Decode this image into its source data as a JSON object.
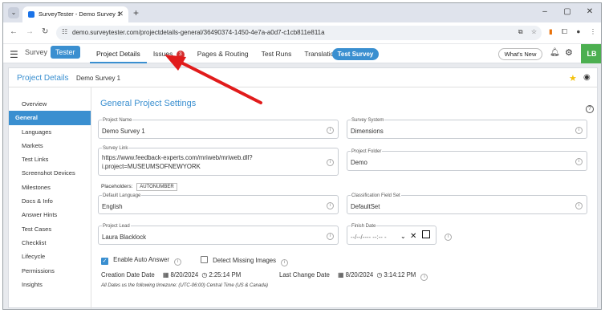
{
  "browser": {
    "tab_title": "SurveyTester - Demo Survey 1",
    "url": "demo.surveytester.com/projectdetails-general/36490374-1450-4e7a-a0d7-c1cb811e811a",
    "window_controls": [
      "–",
      "▢",
      "✕"
    ]
  },
  "app": {
    "logo_survey": "Survey",
    "logo_tester": "Tester",
    "nav": [
      {
        "label": "Project Details",
        "active": true
      },
      {
        "label": "Issues",
        "badge": "3"
      },
      {
        "label": "Pages & Routing"
      },
      {
        "label": "Test Runs"
      },
      {
        "label": "Translations"
      }
    ],
    "test_survey_label": "Test Survey",
    "whats_new_label": "What's New",
    "avatar_initials": "LB",
    "accent_color": "#3a8fd0"
  },
  "header": {
    "title": "Project Details",
    "subtitle": "Demo Survey 1"
  },
  "sidebar": {
    "items": [
      {
        "label": "Overview"
      },
      {
        "label": "General",
        "active": true
      },
      {
        "label": "Languages"
      },
      {
        "label": "Markets"
      },
      {
        "label": "Test Links"
      },
      {
        "label": "Screenshot Devices"
      },
      {
        "label": "Milestones"
      },
      {
        "label": "Docs & Info"
      },
      {
        "label": "Answer Hints"
      },
      {
        "label": "Test Cases"
      },
      {
        "label": "Checklist"
      },
      {
        "label": "Lifecycle"
      },
      {
        "label": "Permissions"
      },
      {
        "label": "Insights"
      }
    ]
  },
  "settings": {
    "title": "General Project Settings",
    "project_name_label": "Project Name",
    "project_name": "Demo Survey 1",
    "survey_system_label": "Survey System",
    "survey_system": "Dimensions",
    "survey_link_label": "Survey Link",
    "survey_link_line1": "https://www.feedback-experts.com/mriweb/mriweb.dll?",
    "survey_link_line2": "i.project=MUSEUMSOFNEWYORK",
    "project_folder_label": "Project Folder",
    "project_folder": "Demo",
    "placeholders_label": "Placeholders:",
    "placeholder_chip": "AUTONUMBER",
    "default_language_label": "Default Language",
    "default_language": "English",
    "classification_label": "Classification Field Set",
    "classification": "DefaultSet",
    "project_lead_label": "Project Lead",
    "project_lead": "Laura Blacklock",
    "finish_date_label": "Finish Date",
    "finish_date_placeholder": "--/--/---- --:-- -",
    "auto_answer_label": "Enable Auto Answer",
    "auto_answer_checked": true,
    "detect_missing_label": "Detect Missing Images",
    "detect_missing_checked": false,
    "creation_label": "Creation Date Date",
    "creation_date": "8/20/2024",
    "creation_time": "2:25:14 PM",
    "last_change_label": "Last Change Date",
    "last_change_date": "8/20/2024",
    "last_change_time": "3:14:12 PM",
    "timezone_note": "All Dates us the following timezone: (UTC-06:00) Central Time (US & Canada)"
  }
}
